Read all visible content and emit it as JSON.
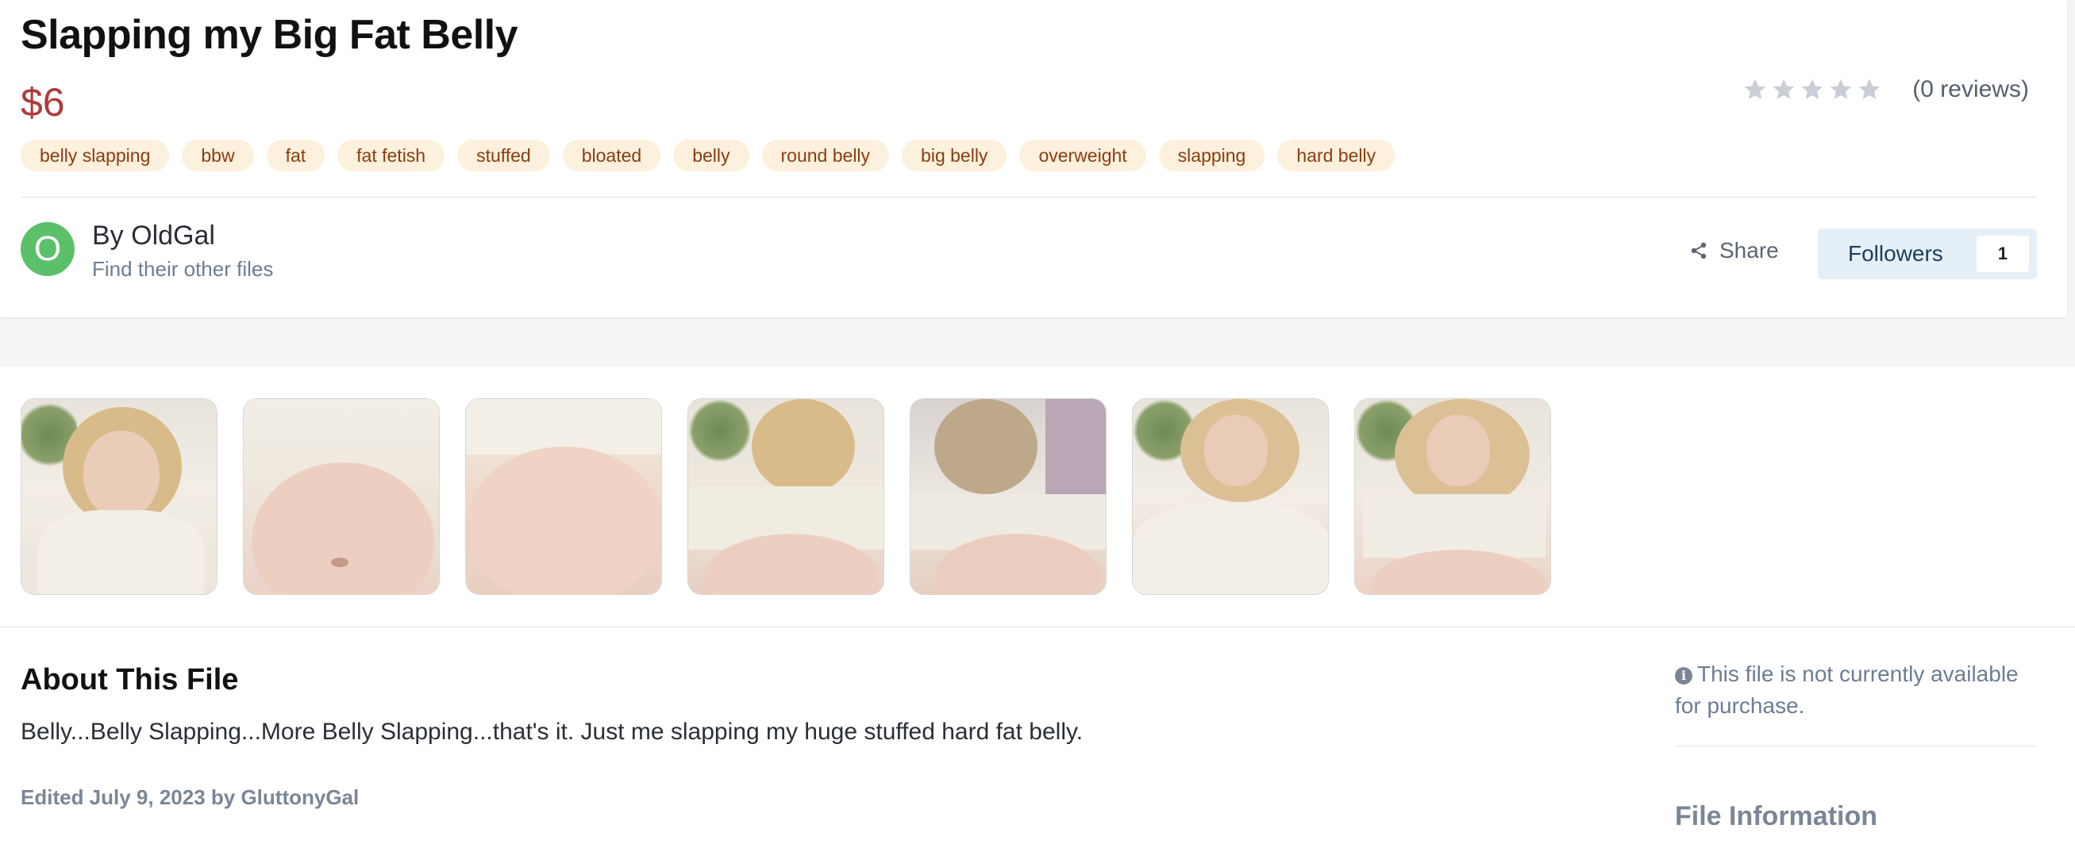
{
  "file": {
    "title": "Slapping my Big Fat Belly",
    "price": "$6",
    "rating": {
      "stars": 0,
      "max": 5,
      "reviews_label": "(0 reviews)"
    },
    "tags": [
      "belly slapping",
      "bbw",
      "fat",
      "fat fetish",
      "stuffed",
      "bloated",
      "belly",
      "round belly",
      "big belly",
      "overweight",
      "slapping",
      "hard belly"
    ]
  },
  "author": {
    "avatar_letter": "O",
    "byline": "By OldGal",
    "other_files_link": "Find their other files"
  },
  "actions": {
    "share_label": "Share",
    "followers_label": "Followers",
    "followers_count": "1"
  },
  "gallery": {
    "thumbnails": [
      {
        "alt": "preview-1"
      },
      {
        "alt": "preview-2"
      },
      {
        "alt": "preview-3"
      },
      {
        "alt": "preview-4"
      },
      {
        "alt": "preview-5"
      },
      {
        "alt": "preview-6"
      },
      {
        "alt": "preview-7"
      }
    ]
  },
  "about": {
    "heading": "About This File",
    "description": "Belly...Belly Slapping...More Belly Slapping...that's it. Just me slapping my huge stuffed hard fat belly.",
    "edited": "Edited July 9, 2023 by GluttonyGal"
  },
  "sidebar": {
    "notice": "This file is not currently available for purchase.",
    "file_info_heading": "File Information"
  },
  "colors": {
    "price": "#b03a3a",
    "tag_bg": "#fdf0dc",
    "tag_text": "#8a3d10",
    "avatar_bg": "#5cc06a",
    "followers_bg": "#e4eff8"
  }
}
